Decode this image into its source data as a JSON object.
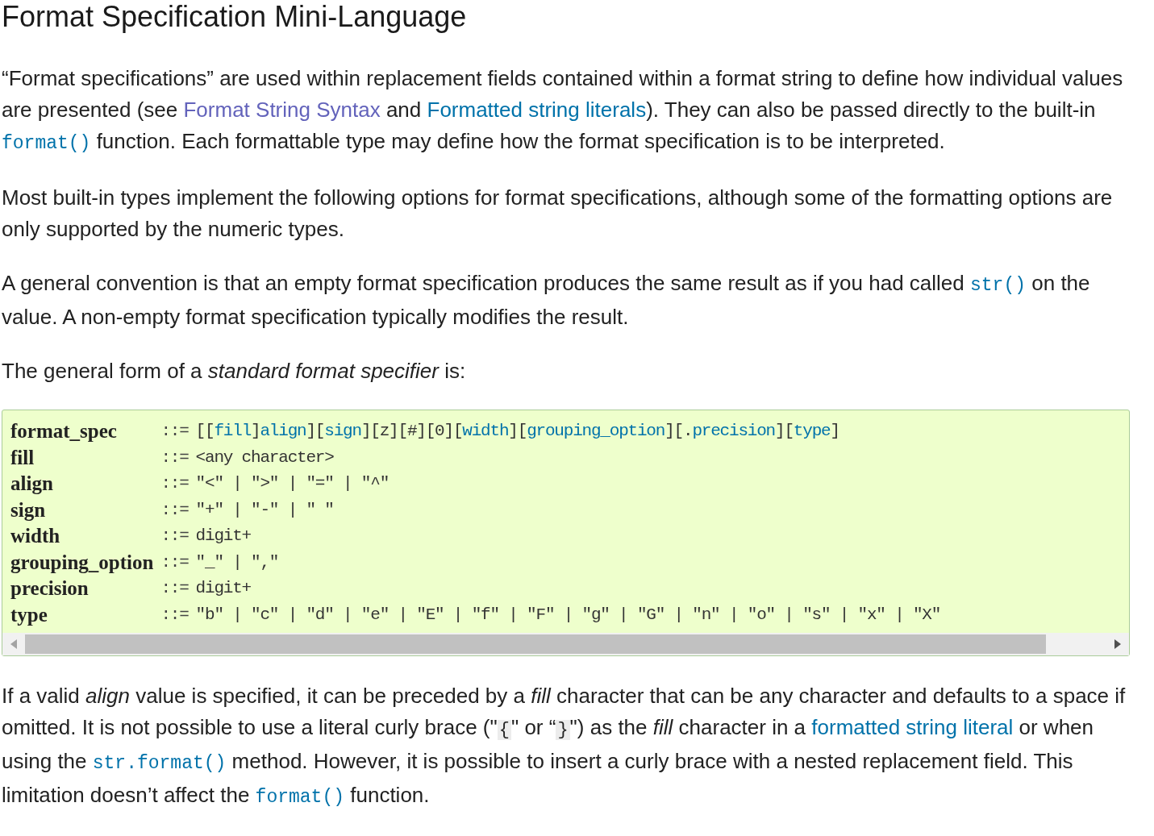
{
  "heading": "Format Specification Mini-Language",
  "paragraphs": [
    [
      {
        "kind": "text",
        "text": "“Format specifications” are used within replacement fields contained within a format string to define how individual values are presented (see "
      },
      {
        "kind": "link",
        "text": "Format String Syntax",
        "visited": true
      },
      {
        "kind": "text",
        "text": " and "
      },
      {
        "kind": "link",
        "text": "Formatted string literals",
        "visited": false
      },
      {
        "kind": "text",
        "text": "). They can also be passed directly to the built-in "
      },
      {
        "kind": "code",
        "text": "format()"
      },
      {
        "kind": "text",
        "text": " function. Each formattable type may define how the format specification is to be interpreted."
      }
    ],
    [
      {
        "kind": "text",
        "text": "Most built-in types implement the following options for format specifications, although some of the formatting options are only supported by the numeric types."
      }
    ],
    [
      {
        "kind": "text",
        "text": "A general convention is that an empty format specification produces the same result as if you had called "
      },
      {
        "kind": "code",
        "text": "str()"
      },
      {
        "kind": "text",
        "text": " on the value. A non-empty format specification typically modifies the result."
      }
    ],
    [
      {
        "kind": "text",
        "text": "The general form of a *standard format specifier* is:"
      }
    ]
  ],
  "grammar": [
    {
      "name": "format_spec",
      "op": "::=",
      "definition": [
        {
          "kind": "text",
          "text": "[["
        },
        {
          "kind": "ref",
          "text": "fill"
        },
        {
          "kind": "text",
          "text": "]"
        },
        {
          "kind": "ref",
          "text": "align"
        },
        {
          "kind": "text",
          "text": "]["
        },
        {
          "kind": "ref",
          "text": "sign"
        },
        {
          "kind": "text",
          "text": "][z][#][0]["
        },
        {
          "kind": "ref",
          "text": "width"
        },
        {
          "kind": "text",
          "text": "]["
        },
        {
          "kind": "ref",
          "text": "grouping_option"
        },
        {
          "kind": "text",
          "text": "][."
        },
        {
          "kind": "ref",
          "text": "precision"
        },
        {
          "kind": "text",
          "text": "]["
        },
        {
          "kind": "ref",
          "text": "type"
        },
        {
          "kind": "text",
          "text": "]"
        }
      ]
    },
    {
      "name": "fill",
      "op": "::=",
      "definition": [
        {
          "kind": "text",
          "text": "<any character>"
        }
      ]
    },
    {
      "name": "align",
      "op": "::=",
      "definition": [
        {
          "kind": "text",
          "text": "\"<\" | \">\" | \"=\" | \"^\""
        }
      ]
    },
    {
      "name": "sign",
      "op": "::=",
      "definition": [
        {
          "kind": "text",
          "text": "\"+\" | \"-\" | \" \""
        }
      ]
    },
    {
      "name": "width",
      "op": "::=",
      "definition": [
        {
          "kind": "text",
          "text": "digit+"
        }
      ]
    },
    {
      "name": "grouping_option",
      "op": "::=",
      "definition": [
        {
          "kind": "text",
          "text": "\"_\" | \",\""
        }
      ]
    },
    {
      "name": "precision",
      "op": "::=",
      "definition": [
        {
          "kind": "text",
          "text": "digit+"
        }
      ]
    },
    {
      "name": "type",
      "op": "::=",
      "definition": [
        {
          "kind": "text",
          "text": "\"b\" | \"c\" | \"d\" | \"e\" | \"E\" | \"f\" | \"F\" | \"g\" | \"G\" | \"n\" | \"o\" | \"s\" | \"x\" | \"X\""
        }
      ]
    }
  ],
  "after": [
    [
      {
        "kind": "text",
        "text": "If a valid *align* value is specified, it can be preceded by a *fill* character that can be any character and defaults to a space if omitted. It is not possible to use a literal curly brace (\""
      },
      {
        "kind": "literal",
        "text": "{"
      },
      {
        "kind": "text",
        "text": "\" or “"
      },
      {
        "kind": "literal",
        "text": "}"
      },
      {
        "kind": "text",
        "text": "\") as the *fill* character in a "
      },
      {
        "kind": "link",
        "text": "formatted string literal",
        "visited": false
      },
      {
        "kind": "text",
        "text": " or when using the "
      },
      {
        "kind": "code",
        "text": "str.format()"
      },
      {
        "kind": "text",
        "text": " method. However, it is possible to insert a curly brace with a nested replacement field. This limitation doesn’t affect the "
      },
      {
        "kind": "code",
        "text": "format()"
      },
      {
        "kind": "text",
        "text": " function."
      }
    ]
  ]
}
